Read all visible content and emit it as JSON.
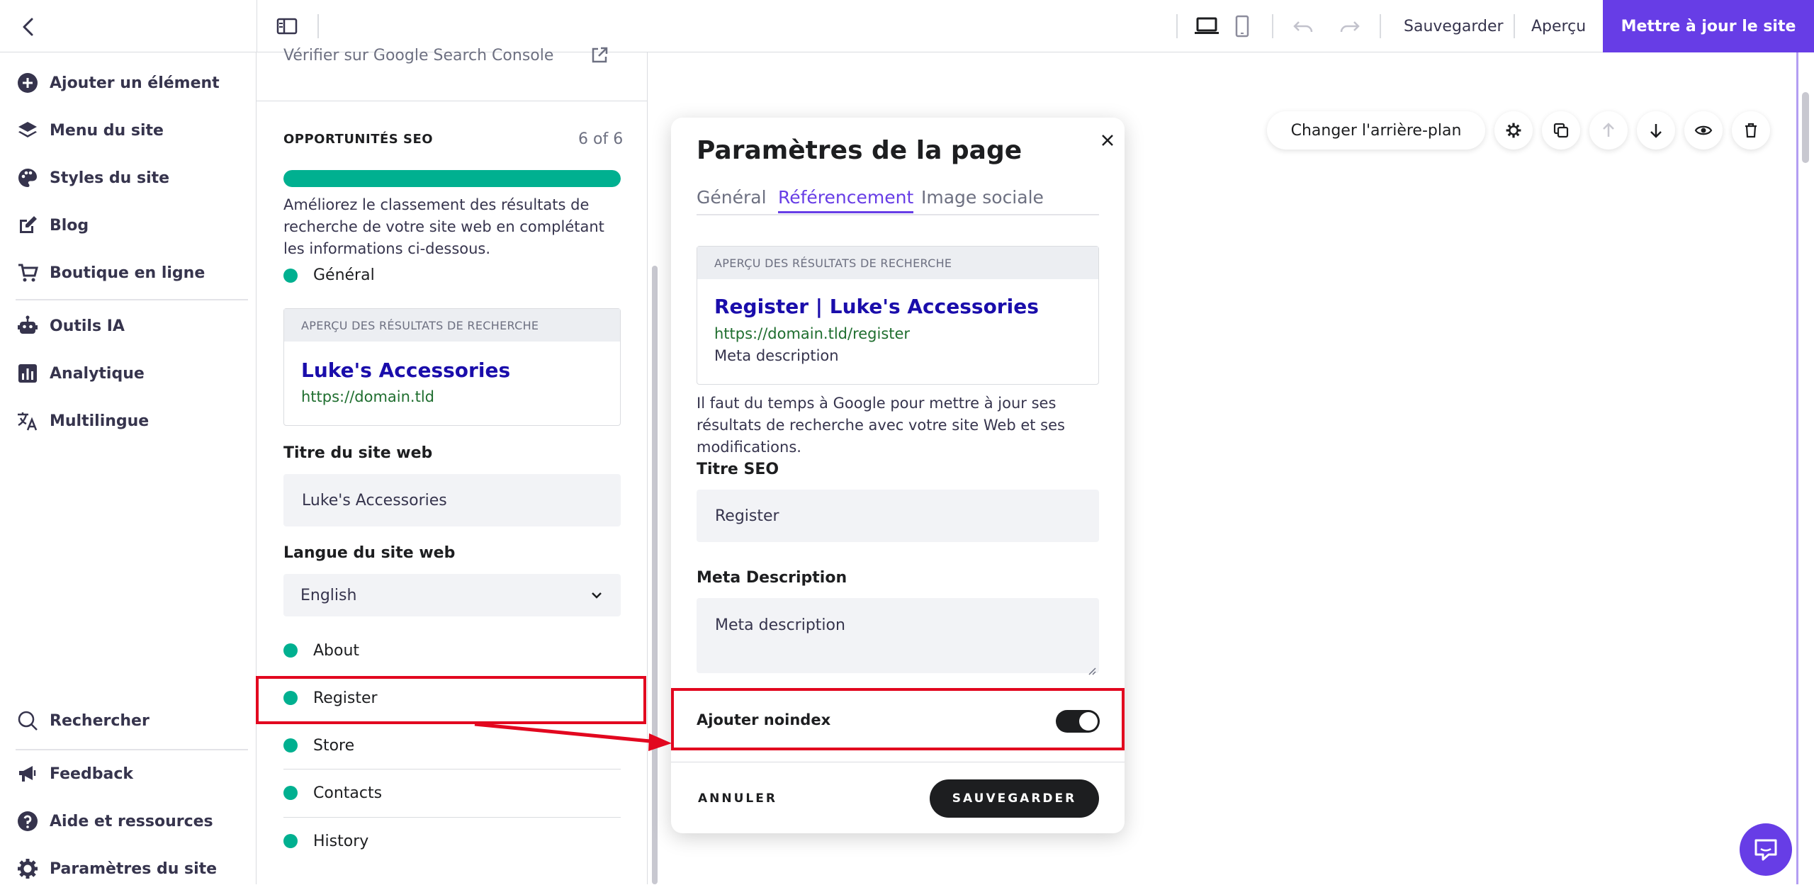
{
  "topbar": {
    "save_label": "Sauvegarder",
    "preview_label": "Aperçu",
    "update_label": "Mettre à jour le site"
  },
  "sidebar": {
    "items": [
      {
        "label": "Ajouter un élément",
        "icon": "plus-circle-icon"
      },
      {
        "label": "Menu du site",
        "icon": "layers-icon"
      },
      {
        "label": "Styles du site",
        "icon": "palette-icon"
      },
      {
        "label": "Blog",
        "icon": "edit-icon"
      },
      {
        "label": "Boutique en ligne",
        "icon": "cart-icon"
      },
      {
        "label": "Outils IA",
        "icon": "robot-icon"
      },
      {
        "label": "Analytique",
        "icon": "chart-icon"
      },
      {
        "label": "Multilingue",
        "icon": "translate-icon"
      }
    ],
    "bottom": [
      {
        "label": "Rechercher",
        "icon": "search-icon"
      },
      {
        "label": "Feedback",
        "icon": "megaphone-icon"
      },
      {
        "label": "Aide et ressources",
        "icon": "help-icon"
      },
      {
        "label": "Paramètres du site",
        "icon": "gear-icon"
      }
    ]
  },
  "seo_panel": {
    "verify_label": "Vérifier sur Google Search Console",
    "opportunities_title": "OPPORTUNITÉS SEO",
    "count": "6 of 6",
    "progress": 1.0,
    "description": "Améliorez le classement des résultats de recherche de votre site web en complétant les informations ci-dessous.",
    "general_label": "Général",
    "preview_header": "APERÇU DES RÉSULTATS DE RECHERCHE",
    "preview_title": "Luke's Accessories",
    "preview_url": "https://domain.tld",
    "site_title_label": "Titre du site web",
    "site_title_value": "Luke's Accessories",
    "language_label": "Langue du site web",
    "language_value": "English",
    "pages": [
      "About",
      "Register",
      "Store",
      "Contacts",
      "History"
    ]
  },
  "modal": {
    "title": "Paramètres de la page",
    "tabs": [
      "Général",
      "Référencement",
      "Image sociale"
    ],
    "active_tab": "Référencement",
    "preview_header": "APERÇU DES RÉSULTATS DE RECHERCHE",
    "preview_title": "Register | Luke's Accessories",
    "preview_url": "https://domain.tld/register",
    "preview_desc": "Meta description",
    "info_text": "Il faut du temps à Google pour mettre à jour ses résultats de recherche avec votre site Web et ses modifications.",
    "seo_title_label": "Titre SEO",
    "seo_title_value": "Register",
    "meta_label": "Meta Description",
    "meta_value": "Meta description",
    "noindex_label": "Ajouter noindex",
    "noindex_on": true,
    "cancel_label": "ANNULER",
    "save_label": "SAUVEGARDER"
  },
  "canvas": {
    "change_bg_label": "Changer l'arrière-plan"
  },
  "colors": {
    "accent": "#673de6",
    "success": "#00b090",
    "annotation": "#e2071f",
    "link": "#1a0dab",
    "url": "#1f6e2f"
  }
}
